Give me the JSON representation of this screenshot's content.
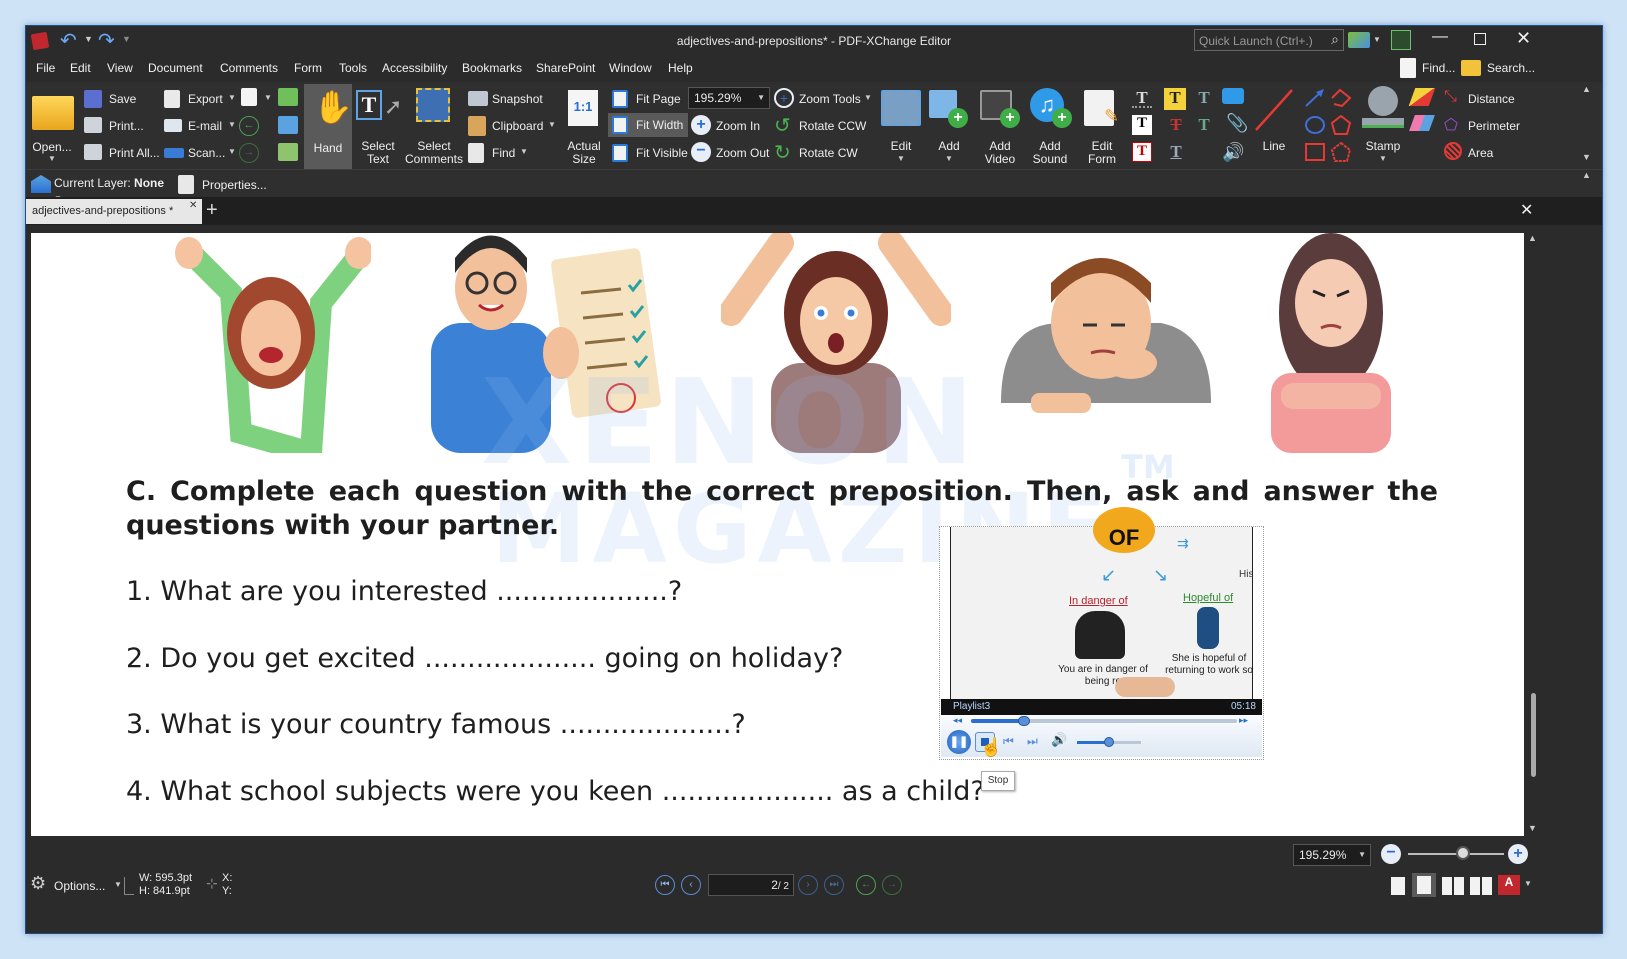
{
  "window": {
    "title": "adjectives-and-prepositions* - PDF-XChange Editor",
    "quick_launch_placeholder": "Quick Launch (Ctrl+.)"
  },
  "menu": [
    "File",
    "Edit",
    "View",
    "Document",
    "Comments",
    "Form",
    "Tools",
    "Accessibility",
    "Bookmarks",
    "SharePoint",
    "Window",
    "Help"
  ],
  "menu_right": {
    "find": "Find...",
    "search": "Search..."
  },
  "ribbon": {
    "open": "Open...",
    "save": "Save",
    "print": "Print...",
    "print_all": "Print All...",
    "export": "Export",
    "email": "E-mail",
    "scan": "Scan...",
    "hand": "Hand",
    "select_text": "Select Text",
    "select_comments": "Select Comments",
    "snapshot": "Snapshot",
    "clipboard": "Clipboard",
    "find": "Find",
    "actual_size": "Actual Size",
    "fit_page": "Fit Page",
    "fit_width": "Fit Width",
    "fit_visible": "Fit Visible",
    "zoom_value": "195.29%",
    "zoom_in": "Zoom In",
    "zoom_out": "Zoom Out",
    "zoom_tools": "Zoom Tools",
    "rotate_ccw": "Rotate CCW",
    "rotate_cw": "Rotate CW",
    "edit": "Edit",
    "add": "Add",
    "add_video": "Add Video",
    "add_sound": "Add Sound",
    "edit_form": "Edit Form",
    "line": "Line",
    "stamp": "Stamp",
    "distance": "Distance",
    "perimeter": "Perimeter",
    "area": "Area"
  },
  "layer": {
    "label": "Current Layer:",
    "value": "None",
    "properties": "Properties..."
  },
  "tab": {
    "name": "adjectives-and-prepositions *"
  },
  "document": {
    "heading": "C. Complete each question with the correct preposition. Then, ask and answer the questions with your partner.",
    "questions": [
      "1. What are you interested ....................?",
      "2. Do you get excited .................... going on holiday?",
      "3. What is your country famous ....................?",
      "4. What school subjects were you keen .................... as a child?"
    ],
    "watermark_line1": "XENON",
    "watermark_line2": "MAGAZINE",
    "watermark_tm": "TM"
  },
  "player": {
    "video_badge": "OF",
    "left_caption": "In danger of",
    "right_caption": "Hopeful of",
    "left_sub": "You are in danger of being re",
    "right_sub": "She is hopeful of returning to work so",
    "edge_text": "His",
    "playlist": "Playlist3",
    "duration": "05:18",
    "progress": 0.2,
    "volume": 0.5,
    "tooltip": "Stop"
  },
  "status": {
    "options": "Options...",
    "width": "W: 595.3pt",
    "height": "H: 841.9pt",
    "x": "X:",
    "y": "Y:",
    "page_value": "2",
    "page_total": "/ 2",
    "zoom_value": "195.29%"
  },
  "colors": {
    "accent": "#3c7ce0",
    "chrome": "#2b2b2b",
    "ribbon": "#2f2f2f"
  }
}
